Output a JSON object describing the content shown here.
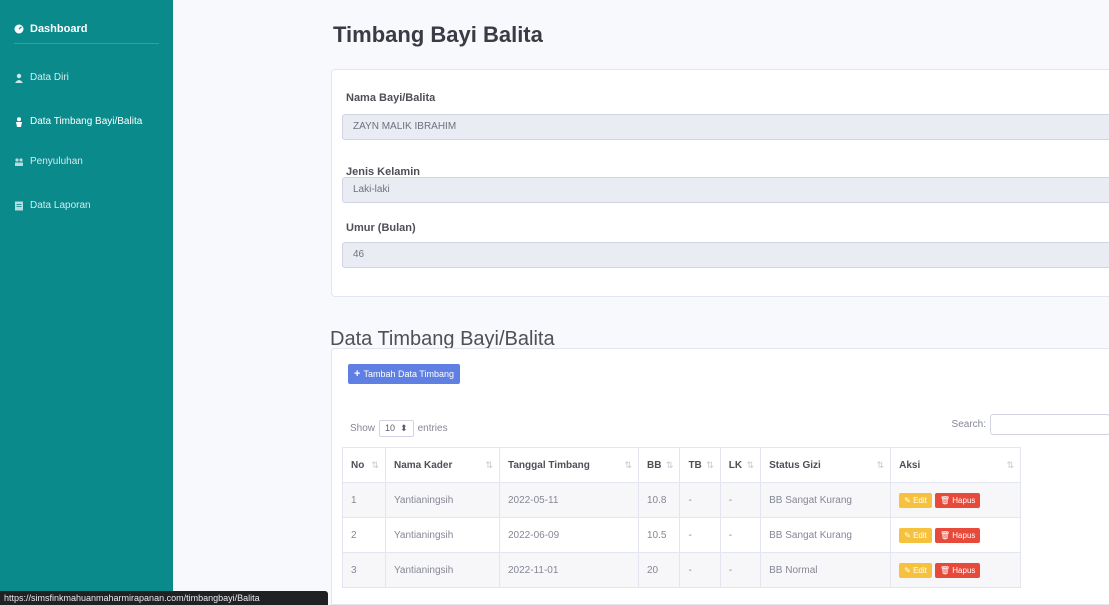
{
  "sidebar": {
    "dashboard": "Dashboard",
    "items": [
      {
        "label": "Data Diri",
        "icon": "user-icon"
      },
      {
        "label": "Data Timbang Bayi/Balita",
        "icon": "baby-icon"
      },
      {
        "label": "Penyuluhan",
        "icon": "users-icon"
      },
      {
        "label": "Data Laporan",
        "icon": "report-icon"
      }
    ],
    "active_index": 1
  },
  "page": {
    "title": "Timbang Bayi Balita"
  },
  "form": {
    "nama_label": "Nama Bayi/Balita",
    "nama_value": "ZAYN MALIK IBRAHIM",
    "jk_label": "Jenis Kelamin",
    "jk_value": "Laki-laki",
    "umur_label": "Umur (Bulan)",
    "umur_value": "46"
  },
  "section": {
    "title": "Data Timbang Bayi/Balita",
    "add_button": "Tambah Data Timbang",
    "show_label": "Show",
    "entries_value": "10",
    "entries_label": "entries",
    "search_label": "Search:"
  },
  "table": {
    "headers": [
      "No",
      "Nama Kader",
      "Tanggal Timbang",
      "BB",
      "TB",
      "LK",
      "Status Gizi",
      "Aksi"
    ],
    "rows": [
      {
        "no": "1",
        "kader": "Yantianingsih",
        "tanggal": "2022-05-11",
        "bb": "10.8",
        "tb": "-",
        "lk": "-",
        "status": "BB Sangat Kurang"
      },
      {
        "no": "2",
        "kader": "Yantianingsih",
        "tanggal": "2022-06-09",
        "bb": "10.5",
        "tb": "-",
        "lk": "-",
        "status": "BB Sangat Kurang"
      },
      {
        "no": "3",
        "kader": "Yantianingsih",
        "tanggal": "2022-11-01",
        "bb": "20",
        "tb": "-",
        "lk": "-",
        "status": "BB Normal"
      }
    ],
    "edit_label": "Edit",
    "hapus_label": "Hapus"
  },
  "statusbar": {
    "url": "https://simsfinkmahuanmaharmirapanan.com/timbangbayi/Balita"
  },
  "colors": {
    "sidebar": "#0b8a8c",
    "primary": "#4e73df",
    "warning": "#f6c23e",
    "danger": "#e74a3b"
  }
}
